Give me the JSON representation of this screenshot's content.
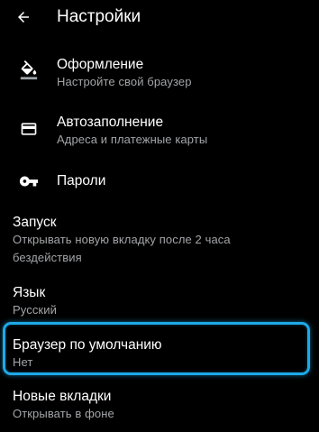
{
  "header": {
    "title": "Настройки",
    "back_icon": "arrow-back-icon"
  },
  "items": [
    {
      "title": "Оформление",
      "subtitle": "Настройте свой браузер",
      "icon": "paint-bucket-icon"
    },
    {
      "title": "Автозаполнение",
      "subtitle": "Адреса и платежные карты",
      "icon": "credit-card-icon"
    },
    {
      "title": "Пароли",
      "icon": "key-icon"
    },
    {
      "title": "Запуск",
      "subtitle_line1": "Открывать новую вкладку после 2 часа",
      "subtitle_line2": "бездействия"
    },
    {
      "title": "Язык",
      "subtitle": "Русский"
    },
    {
      "title": "Браузер по умолчанию",
      "subtitle": "Нет",
      "highlighted": true
    },
    {
      "title": "Новые вкладки",
      "subtitle": "Открывать в фоне"
    }
  ],
  "colors": {
    "background": "#000000",
    "text": "#ffffff",
    "subtext": "#a3a5a8",
    "highlight": "#1ea9e8"
  }
}
